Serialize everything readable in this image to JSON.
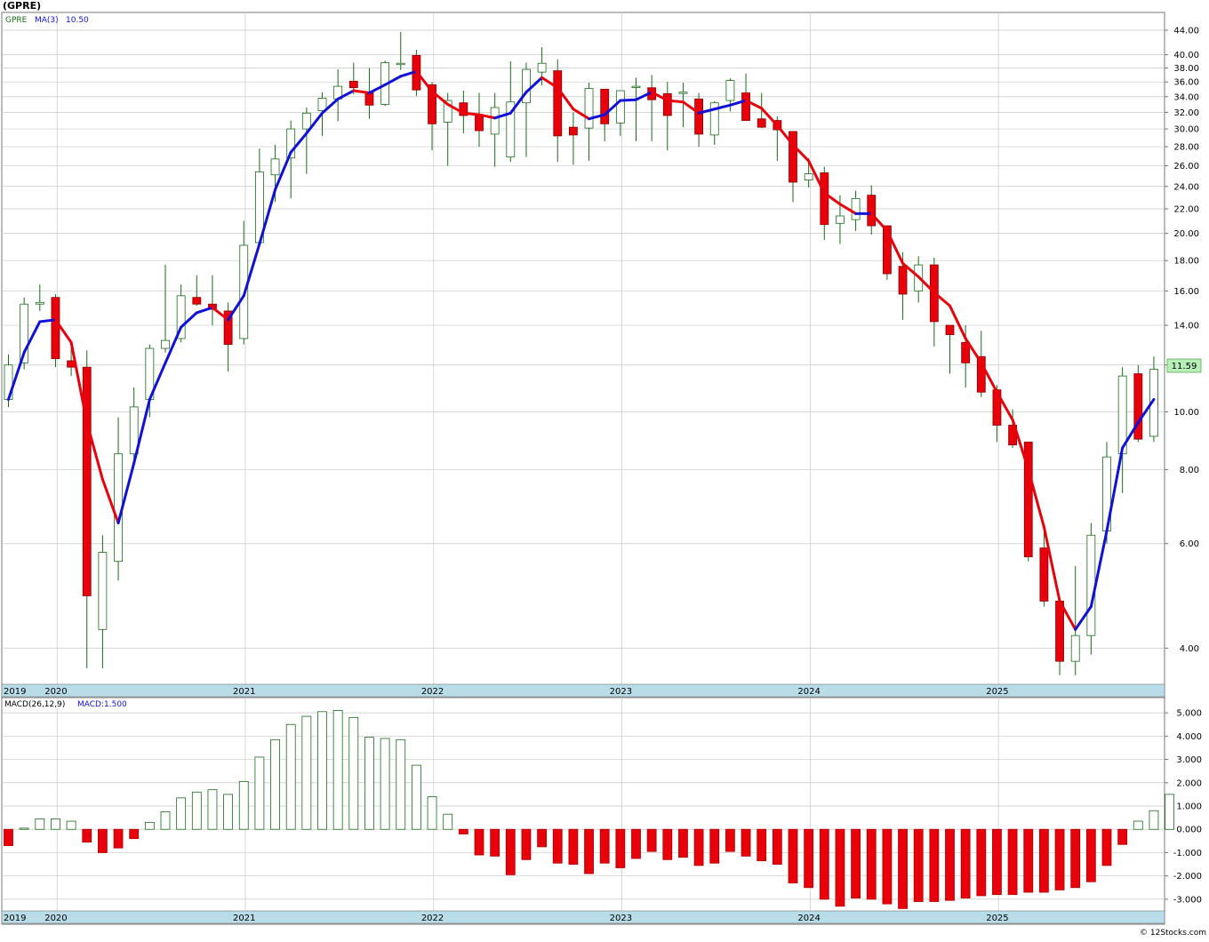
{
  "header": {
    "title": "(GPRE)",
    "legend_symbol": "GPRE",
    "legend_ma_label": "MA(3)",
    "legend_ma_value": "10.50",
    "legend_macd_label": "MACD(26,12,9)",
    "legend_macd_value": "MACD:1.500",
    "last_price_badge": "11.59",
    "watermark": "© 12Stocks.com"
  },
  "colors": {
    "up_candle": "#1a6b1a",
    "down_candle": "#e8000b",
    "ma_rising": "#1010d8",
    "ma_falling": "#e8000b",
    "axis_bar": "#b8dde8",
    "grid": "#c8c8c8",
    "badge_bg": "#b6f0b6"
  },
  "chart_data": [
    {
      "type": "candlestick",
      "name": "price",
      "scale": "log",
      "ylim": [
        3.5,
        46.5
      ],
      "ticks": [
        "44.00",
        "40.00",
        "38.00",
        "36.00",
        "34.00",
        "32.00",
        "30.00",
        "28.00",
        "26.00",
        "24.00",
        "22.00",
        "20.00",
        "18.00",
        "16.00",
        "14.00",
        "12.00",
        "10.00",
        "8.00",
        "6.00",
        "4.00"
      ],
      "x_axis_labels": [
        "2019",
        "2020",
        "2021",
        "2022",
        "2023",
        "2024",
        "2025"
      ],
      "series": [
        {
          "name": "GPRE",
          "ohlc": [
            [
              10.5,
              12.5,
              10.2,
              12.0
            ],
            [
              12.1,
              15.6,
              11.8,
              15.2
            ],
            [
              15.2,
              16.4,
              14.8,
              15.3
            ],
            [
              15.6,
              15.8,
              11.9,
              12.3
            ],
            [
              12.2,
              12.9,
              11.5,
              11.9
            ],
            [
              11.9,
              12.7,
              3.7,
              4.9
            ],
            [
              4.3,
              6.2,
              3.7,
              5.8
            ],
            [
              5.6,
              9.8,
              5.2,
              8.5
            ],
            [
              8.5,
              11.0,
              8.3,
              10.2
            ],
            [
              10.5,
              13.0,
              9.8,
              12.8
            ],
            [
              12.8,
              17.7,
              12.6,
              13.2
            ],
            [
              13.3,
              16.4,
              13.1,
              15.7
            ],
            [
              15.6,
              17.0,
              15.1,
              15.2
            ],
            [
              15.2,
              17.0,
              14.0,
              14.9
            ],
            [
              14.8,
              15.3,
              11.7,
              13.0
            ],
            [
              13.3,
              21.0,
              13.0,
              19.1
            ],
            [
              19.3,
              27.8,
              19.0,
              25.4
            ],
            [
              25.1,
              28.2,
              22.6,
              26.7
            ],
            [
              26.8,
              31.0,
              22.9,
              30.0
            ],
            [
              30.0,
              32.6,
              25.2,
              31.9
            ],
            [
              32.2,
              34.6,
              29.2,
              33.8
            ],
            [
              33.7,
              37.8,
              30.9,
              35.4
            ],
            [
              36.1,
              38.8,
              34.3,
              35.2
            ],
            [
              34.6,
              38.0,
              31.2,
              32.9
            ],
            [
              33.0,
              39.1,
              32.8,
              38.8
            ],
            [
              38.6,
              43.7,
              37.7,
              38.7
            ],
            [
              39.9,
              40.8,
              34.1,
              34.9
            ],
            [
              35.6,
              36.0,
              27.6,
              30.6
            ],
            [
              30.8,
              34.5,
              26.0,
              33.5
            ],
            [
              33.2,
              34.8,
              29.5,
              31.6
            ],
            [
              31.6,
              34.5,
              28.0,
              29.8
            ],
            [
              29.4,
              34.5,
              25.9,
              32.6
            ],
            [
              26.9,
              39.0,
              26.4,
              33.3
            ],
            [
              33.2,
              38.8,
              26.9,
              37.8
            ],
            [
              37.4,
              41.2,
              35.5,
              38.7
            ],
            [
              37.6,
              39.3,
              26.4,
              29.2
            ],
            [
              30.2,
              32.0,
              26.1,
              29.3
            ],
            [
              30.1,
              35.9,
              26.5,
              35.1
            ],
            [
              35.0,
              35.0,
              28.6,
              30.6
            ],
            [
              30.7,
              34.8,
              29.2,
              34.8
            ],
            [
              35.3,
              36.6,
              28.6,
              35.4
            ],
            [
              35.2,
              37.0,
              28.6,
              33.6
            ],
            [
              34.4,
              36.0,
              27.6,
              31.6
            ],
            [
              34.6,
              35.9,
              30.2,
              34.6
            ],
            [
              33.7,
              34.5,
              28.0,
              29.4
            ],
            [
              29.3,
              33.4,
              28.2,
              33.2
            ],
            [
              33.5,
              36.5,
              32.1,
              36.2
            ],
            [
              34.5,
              37.2,
              31.0,
              31.0
            ],
            [
              31.2,
              34.5,
              30.1,
              30.2
            ],
            [
              31.0,
              31.5,
              26.5,
              29.9
            ],
            [
              29.7,
              29.7,
              22.6,
              24.4
            ],
            [
              24.6,
              26.8,
              23.9,
              25.2
            ],
            [
              25.3,
              25.9,
              19.5,
              20.7
            ],
            [
              20.8,
              23.2,
              19.2,
              21.4
            ],
            [
              21.1,
              23.6,
              20.2,
              22.9
            ],
            [
              23.2,
              24.1,
              19.9,
              20.6
            ],
            [
              20.6,
              20.6,
              16.7,
              17.1
            ],
            [
              17.6,
              18.6,
              14.3,
              15.8
            ],
            [
              16.0,
              18.3,
              15.3,
              17.7
            ],
            [
              17.7,
              18.2,
              12.9,
              14.2
            ],
            [
              14.0,
              14.0,
              11.6,
              13.5
            ],
            [
              13.1,
              14.0,
              11.0,
              12.1
            ],
            [
              12.4,
              13.7,
              10.6,
              10.8
            ],
            [
              10.9,
              11.1,
              8.9,
              9.5
            ],
            [
              9.5,
              10.1,
              8.7,
              8.8
            ],
            [
              8.9,
              8.9,
              5.6,
              5.7
            ],
            [
              5.9,
              6.3,
              4.7,
              4.8
            ],
            [
              4.8,
              4.8,
              3.6,
              3.8
            ],
            [
              3.8,
              5.5,
              3.6,
              4.2
            ],
            [
              4.2,
              6.5,
              3.9,
              6.2
            ],
            [
              6.3,
              8.9,
              6.0,
              8.4
            ],
            [
              8.5,
              11.9,
              7.3,
              11.5
            ],
            [
              11.6,
              12.0,
              8.9,
              9.0
            ],
            [
              9.1,
              12.4,
              8.9,
              11.8
            ]
          ]
        },
        {
          "name": "MA(3)",
          "values": [
            10.5,
            12.6,
            14.2,
            14.3,
            13.1,
            9.6,
            7.7,
            6.5,
            8.2,
            10.5,
            12.1,
            13.9,
            14.7,
            15.0,
            14.3,
            15.7,
            19.2,
            23.7,
            27.4,
            29.5,
            31.9,
            33.7,
            34.8,
            34.5,
            35.6,
            36.8,
            37.5,
            34.7,
            33.0,
            31.9,
            31.7,
            31.3,
            31.9,
            34.6,
            36.6,
            35.2,
            32.4,
            31.2,
            31.7,
            33.5,
            33.6,
            34.6,
            33.5,
            33.3,
            31.9,
            32.4,
            32.9,
            33.5,
            32.5,
            30.4,
            28.2,
            26.5,
            23.4,
            22.4,
            21.6,
            21.6,
            20.2,
            17.8,
            16.9,
            15.9,
            15.1,
            13.3,
            12.1,
            10.8,
            9.7,
            8.0,
            6.4,
            4.8,
            4.3,
            4.7,
            6.3,
            8.7,
            9.6,
            10.5
          ]
        }
      ]
    },
    {
      "type": "bar",
      "name": "MACD(26,12,9)",
      "ylim": [
        -3.5,
        5.5
      ],
      "ticks": [
        "5.000",
        "4.000",
        "3.000",
        "2.000",
        "1.000",
        "0.000",
        "-1.000",
        "-2.000",
        "-3.000"
      ],
      "x_axis_labels": [
        "2019",
        "2020",
        "2021",
        "2022",
        "2023",
        "2024",
        "2025"
      ],
      "values": [
        -0.7,
        0.05,
        0.45,
        0.45,
        0.35,
        -0.55,
        -1.0,
        -0.8,
        -0.4,
        0.3,
        0.75,
        1.35,
        1.6,
        1.7,
        1.5,
        2.05,
        3.1,
        3.85,
        4.5,
        4.85,
        5.05,
        5.1,
        4.8,
        3.95,
        3.9,
        3.85,
        2.75,
        1.4,
        0.65,
        -0.2,
        -1.1,
        -1.15,
        -1.95,
        -1.3,
        -0.75,
        -1.45,
        -1.5,
        -1.9,
        -1.45,
        -1.65,
        -1.25,
        -0.95,
        -1.3,
        -1.2,
        -1.55,
        -1.45,
        -0.95,
        -1.15,
        -1.35,
        -1.5,
        -2.3,
        -2.5,
        -3.0,
        -3.3,
        -2.95,
        -3.0,
        -3.2,
        -3.4,
        -3.1,
        -3.1,
        -3.05,
        -2.95,
        -2.85,
        -2.8,
        -2.8,
        -2.7,
        -2.7,
        -2.6,
        -2.5,
        -2.25,
        -1.55,
        -0.65,
        0.35,
        0.8,
        1.5
      ]
    }
  ]
}
